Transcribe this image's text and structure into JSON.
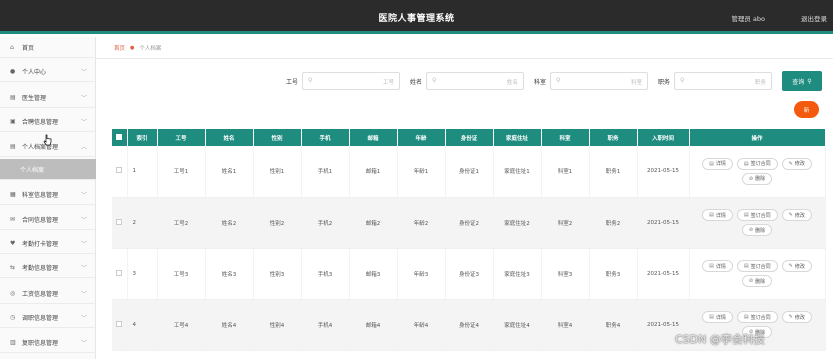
{
  "header": {
    "title": "医院人事管理系统",
    "admin": "管理员 abo",
    "logout": "退出登录"
  },
  "sidebar": {
    "items": [
      {
        "icon": "⌂",
        "label": "首页",
        "chev": ""
      },
      {
        "icon": "●",
        "label": "个人中心",
        "chev": "﹀"
      },
      {
        "icon": "▤",
        "label": "医生管理",
        "chev": "﹀"
      },
      {
        "icon": "▣",
        "label": "合聘信息管理",
        "chev": "﹀"
      },
      {
        "icon": "▤",
        "label": "个人档案管理",
        "chev": "︿"
      },
      {
        "icon": "",
        "label": "个人档案",
        "chev": ""
      },
      {
        "icon": "▦",
        "label": "科室信息管理",
        "chev": "﹀"
      },
      {
        "icon": "✉",
        "label": "合同信息管理",
        "chev": "﹀"
      },
      {
        "icon": "♥",
        "label": "考勤打卡管理",
        "chev": "﹀"
      },
      {
        "icon": "⇆",
        "label": "考勤信息管理",
        "chev": "﹀"
      },
      {
        "icon": "◎",
        "label": "工资信息管理",
        "chev": "﹀"
      },
      {
        "icon": "◷",
        "label": "调职信息管理",
        "chev": "﹀"
      },
      {
        "icon": "▥",
        "label": "复职信息管理",
        "chev": "﹀"
      }
    ]
  },
  "breadcrumb": {
    "home": "首页",
    "current": "个人档案"
  },
  "filters": [
    {
      "label": "工号",
      "placeholder": "工号"
    },
    {
      "label": "姓名",
      "placeholder": "姓名"
    },
    {
      "label": "科室",
      "placeholder": "科室"
    },
    {
      "label": "职务",
      "placeholder": "职务"
    }
  ],
  "buttons": {
    "search": "查询",
    "add": "新"
  },
  "table": {
    "headers": [
      "索引",
      "工号",
      "姓名",
      "性别",
      "手机",
      "邮箱",
      "年龄",
      "身份证",
      "家庭住址",
      "科室",
      "职务",
      "入职时间",
      "操作"
    ],
    "rows": [
      [
        "1",
        "工号1",
        "姓名1",
        "性别1",
        "手机1",
        "邮箱1",
        "年龄1",
        "身份证1",
        "家庭住址1",
        "科室1",
        "职务1",
        "2021-05-15"
      ],
      [
        "2",
        "工号2",
        "姓名2",
        "性别2",
        "手机2",
        "邮箱2",
        "年龄2",
        "身份证2",
        "家庭住址2",
        "科室2",
        "职务2",
        "2021-05-15"
      ],
      [
        "3",
        "工号3",
        "姓名3",
        "性别3",
        "手机3",
        "邮箱3",
        "年龄3",
        "身份证3",
        "家庭住址3",
        "科室3",
        "职务3",
        "2021-05-15"
      ],
      [
        "4",
        "工号4",
        "姓名4",
        "性别4",
        "手机4",
        "邮箱4",
        "年龄4",
        "身份证4",
        "家庭住址4",
        "科室4",
        "职务4",
        "2021-05-15"
      ]
    ],
    "actions": [
      {
        "icon": "▤",
        "label": "详情"
      },
      {
        "icon": "▤",
        "label": "签订合同"
      },
      {
        "icon": "✎",
        "label": "修改"
      },
      {
        "icon": "⊘",
        "label": "删除"
      }
    ]
  },
  "watermark": "CSDN @李会科技",
  "colors": {
    "accent": "#1e8c7f",
    "topbar": "#2b2b2b",
    "add": "#f45a0e"
  }
}
